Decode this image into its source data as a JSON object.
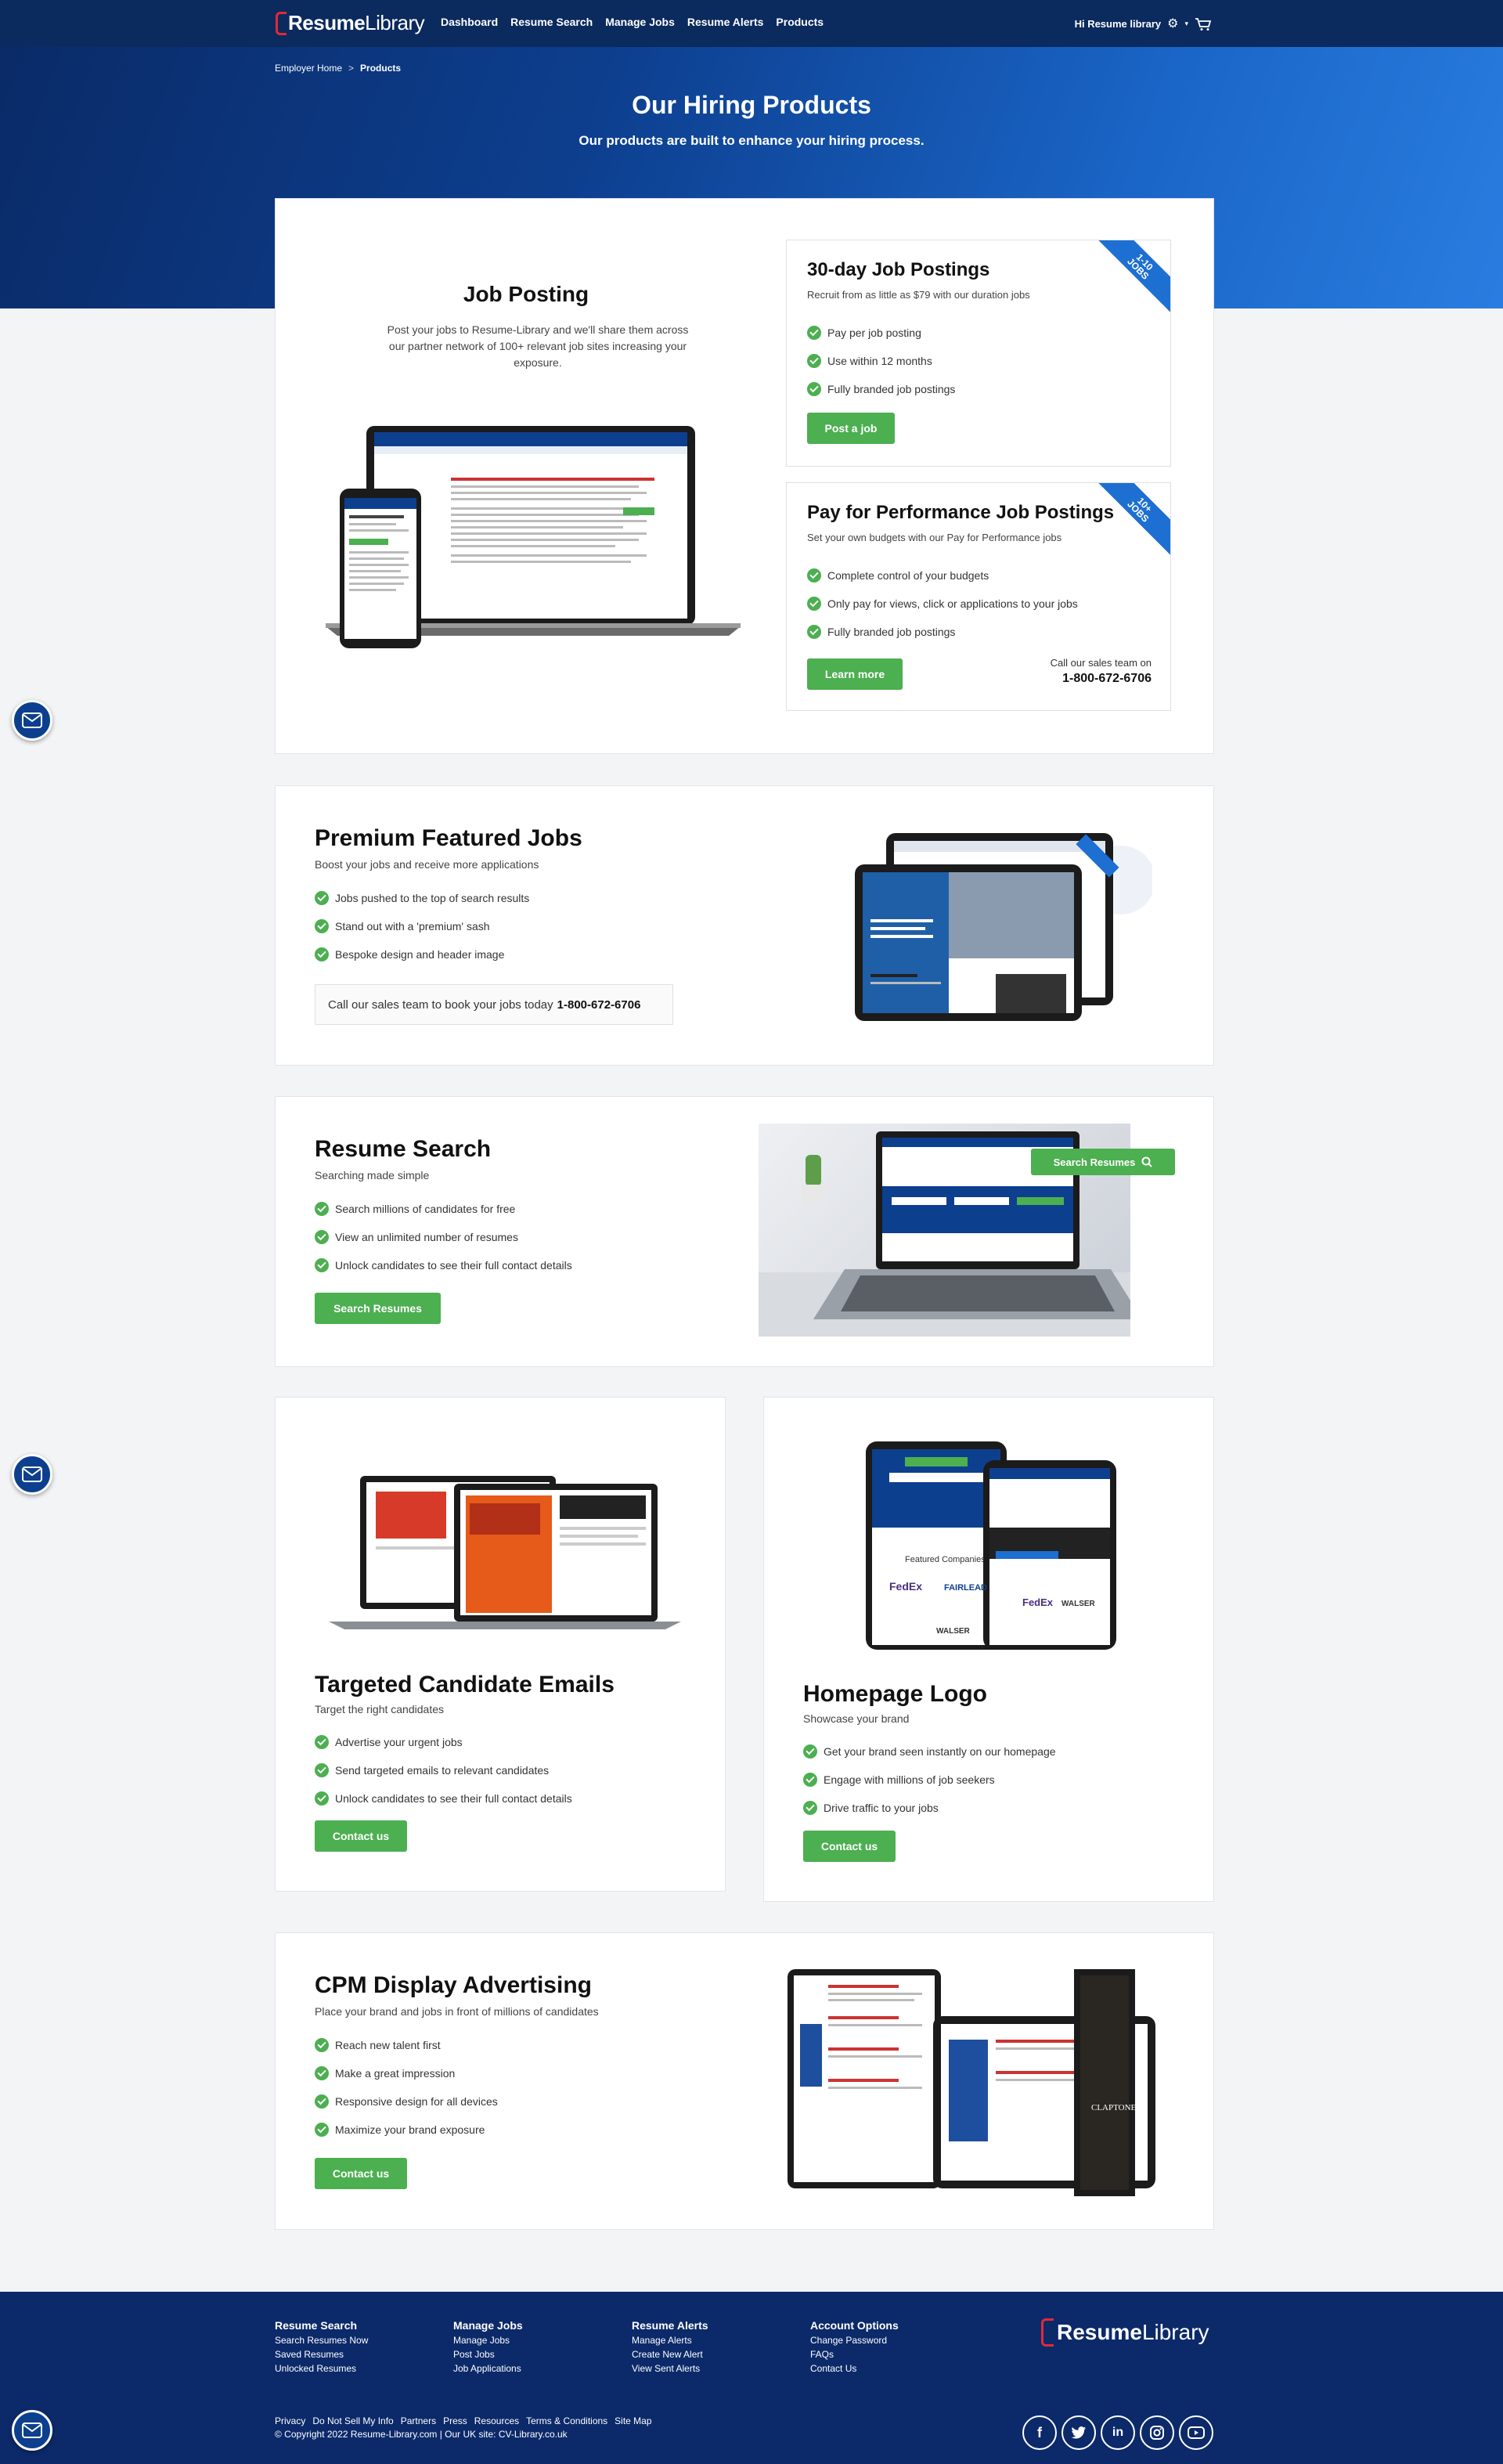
{
  "brand": {
    "logo_bold": "Resume",
    "logo_light": "Library"
  },
  "nav": {
    "links": [
      "Dashboard",
      "Resume Search",
      "Manage Jobs",
      "Resume Alerts",
      "Products"
    ],
    "greeting": "Hi Resume library"
  },
  "breadcrumb": {
    "home": "Employer Home",
    "separator": ">",
    "current": "Products"
  },
  "hero": {
    "title": "Our Hiring Products",
    "subtitle": "Our products are built to enhance your hiring process."
  },
  "job_posting": {
    "title": "Job Posting",
    "description": "Post your jobs to Resume-Library and we'll share them across our partner network of 100+ relevant job sites increasing your exposure.",
    "plans": [
      {
        "title": "30-day Job Postings",
        "subtitle": "Recruit from as little as $79 with our duration jobs",
        "ribbon": "1-10 JOBS",
        "features": [
          "Pay per job posting",
          "Use within 12 months",
          "Fully branded job postings"
        ],
        "button": "Post a job"
      },
      {
        "title": "Pay for Performance Job Postings",
        "subtitle": "Set your own budgets with our Pay for Performance jobs",
        "ribbon": "10+ JOBS",
        "features": [
          "Complete control of your budgets",
          "Only pay for views, click or applications to your jobs",
          "Fully branded job postings"
        ],
        "button": "Learn more",
        "call_text": "Call our sales team on",
        "phone": "1-800-672-6706"
      }
    ]
  },
  "premium": {
    "title": "Premium Featured Jobs",
    "subtitle": "Boost your jobs and receive more applications",
    "features": [
      "Jobs pushed to the top of search results",
      "Stand out with a 'premium' sash",
      "Bespoke design and header image"
    ],
    "call_text": "Call our sales team to book your jobs today",
    "phone": "1-800-672-6706"
  },
  "resume_search": {
    "title": "Resume Search",
    "subtitle": "Searching made simple",
    "features": [
      "Search millions of candidates for free",
      "View an unlimited number of resumes",
      "Unlock candidates to see their full contact details"
    ],
    "button": "Search Resumes",
    "image_button": "Search Resumes"
  },
  "targeted": {
    "title": "Targeted Candidate Emails",
    "subtitle": "Target the right candidates",
    "features": [
      "Advertise your urgent jobs",
      "Send targeted emails to relevant candidates",
      "Unlock candidates to see their full contact details"
    ],
    "button": "Contact us"
  },
  "homepage_logo": {
    "title": "Homepage Logo",
    "subtitle": "Showcase your brand",
    "features": [
      "Get your brand seen instantly on our homepage",
      "Engage with millions of job seekers",
      "Drive traffic to your jobs"
    ],
    "button": "Contact us"
  },
  "cpm": {
    "title": "CPM Display Advertising",
    "subtitle": "Place your brand and jobs in front of millions of candidates",
    "features": [
      "Reach new talent first",
      "Make a great impression",
      "Responsive design for all devices",
      "Maximize your brand exposure"
    ],
    "button": "Contact us"
  },
  "footer": {
    "columns": [
      {
        "title": "Resume Search",
        "links": [
          "Search Resumes Now",
          "Saved Resumes",
          "Unlocked Resumes"
        ]
      },
      {
        "title": "Manage Jobs",
        "links": [
          "Manage Jobs",
          "Post Jobs",
          "Job Applications"
        ]
      },
      {
        "title": "Resume Alerts",
        "links": [
          "Manage Alerts",
          "Create New Alert",
          "View Sent Alerts"
        ]
      },
      {
        "title": "Account Options",
        "links": [
          "Change Password",
          "FAQs",
          "Contact Us"
        ]
      }
    ],
    "bottom_links": [
      "Privacy",
      "Do Not Sell My Info",
      "Partners",
      "Press",
      "Resources",
      "Terms & Conditions",
      "Site Map"
    ],
    "copyright": "© Copyright 2022 Resume-Library.com | Our UK site: CV-Library.co.uk",
    "socials": [
      "facebook-icon",
      "twitter-icon",
      "linkedin-icon",
      "instagram-icon",
      "youtube-icon"
    ]
  },
  "colors": {
    "navy": "#0b2a5e",
    "accent_green": "#4caf50",
    "ribbon_blue": "#1d6fd1",
    "brand_red": "#e02a3a"
  }
}
